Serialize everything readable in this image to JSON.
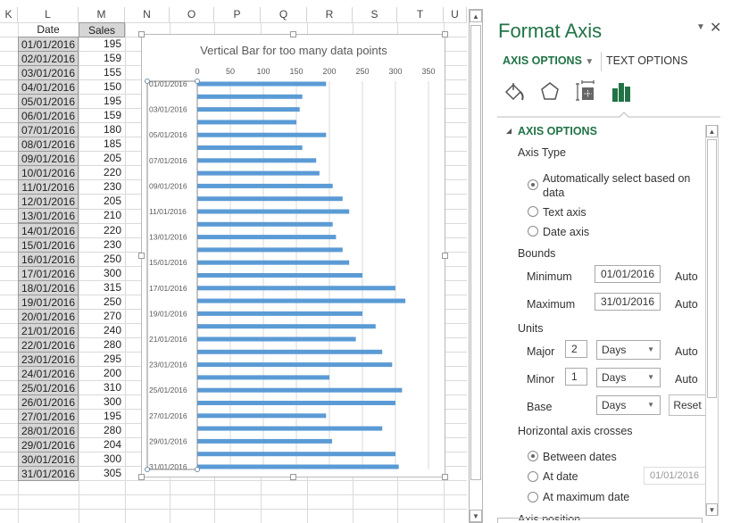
{
  "sheet": {
    "columns": [
      "K",
      "L",
      "M",
      "N",
      "O",
      "P",
      "Q",
      "R",
      "S",
      "T",
      "U"
    ],
    "header_row": {
      "date": "Date",
      "sales": "Sales"
    },
    "rows": [
      {
        "date": "01/01/2016",
        "sales": "195"
      },
      {
        "date": "02/01/2016",
        "sales": "159"
      },
      {
        "date": "03/01/2016",
        "sales": "155"
      },
      {
        "date": "04/01/2016",
        "sales": "150"
      },
      {
        "date": "05/01/2016",
        "sales": "195"
      },
      {
        "date": "06/01/2016",
        "sales": "159"
      },
      {
        "date": "07/01/2016",
        "sales": "180"
      },
      {
        "date": "08/01/2016",
        "sales": "185"
      },
      {
        "date": "09/01/2016",
        "sales": "205"
      },
      {
        "date": "10/01/2016",
        "sales": "220"
      },
      {
        "date": "11/01/2016",
        "sales": "230"
      },
      {
        "date": "12/01/2016",
        "sales": "205"
      },
      {
        "date": "13/01/2016",
        "sales": "210"
      },
      {
        "date": "14/01/2016",
        "sales": "220"
      },
      {
        "date": "15/01/2016",
        "sales": "230"
      },
      {
        "date": "16/01/2016",
        "sales": "250"
      },
      {
        "date": "17/01/2016",
        "sales": "300"
      },
      {
        "date": "18/01/2016",
        "sales": "315"
      },
      {
        "date": "19/01/2016",
        "sales": "250"
      },
      {
        "date": "20/01/2016",
        "sales": "270"
      },
      {
        "date": "21/01/2016",
        "sales": "240"
      },
      {
        "date": "22/01/2016",
        "sales": "280"
      },
      {
        "date": "23/01/2016",
        "sales": "295"
      },
      {
        "date": "24/01/2016",
        "sales": "200"
      },
      {
        "date": "25/01/2016",
        "sales": "310"
      },
      {
        "date": "26/01/2016",
        "sales": "300"
      },
      {
        "date": "27/01/2016",
        "sales": "195"
      },
      {
        "date": "28/01/2016",
        "sales": "280"
      },
      {
        "date": "29/01/2016",
        "sales": "204"
      },
      {
        "date": "30/01/2016",
        "sales": "300"
      },
      {
        "date": "31/01/2016",
        "sales": "305"
      }
    ]
  },
  "chart_data": {
    "type": "bar",
    "orientation": "horizontal",
    "title": "Vertical Bar for too many data points",
    "categories": [
      "01/01/2016",
      "02/01/2016",
      "03/01/2016",
      "04/01/2016",
      "05/01/2016",
      "06/01/2016",
      "07/01/2016",
      "08/01/2016",
      "09/01/2016",
      "10/01/2016",
      "11/01/2016",
      "12/01/2016",
      "13/01/2016",
      "14/01/2016",
      "15/01/2016",
      "16/01/2016",
      "17/01/2016",
      "18/01/2016",
      "19/01/2016",
      "20/01/2016",
      "21/01/2016",
      "22/01/2016",
      "23/01/2016",
      "24/01/2016",
      "25/01/2016",
      "26/01/2016",
      "27/01/2016",
      "28/01/2016",
      "29/01/2016",
      "30/01/2016",
      "31/01/2016"
    ],
    "category_tick_labels": [
      "01/01/2016",
      "03/01/2016",
      "05/01/2016",
      "07/01/2016",
      "09/01/2016",
      "11/01/2016",
      "13/01/2016",
      "15/01/2016",
      "17/01/2016",
      "19/01/2016",
      "21/01/2016",
      "23/01/2016",
      "25/01/2016",
      "27/01/2016",
      "29/01/2016",
      "31/01/2016"
    ],
    "values": [
      195,
      159,
      155,
      150,
      195,
      159,
      180,
      185,
      205,
      220,
      230,
      205,
      210,
      220,
      230,
      250,
      300,
      315,
      250,
      270,
      240,
      280,
      295,
      200,
      310,
      300,
      195,
      280,
      204,
      300,
      305
    ],
    "value_ticks": [
      "0",
      "50",
      "100",
      "150",
      "200",
      "250",
      "300",
      "350"
    ],
    "xlim": [
      0,
      350
    ],
    "value_axis_position": "top",
    "grid": true,
    "bar_color": "#5b9bd5"
  },
  "panel": {
    "title": "Format Axis",
    "tabs": {
      "axis_options": "AXIS OPTIONS",
      "text_options": "TEXT OPTIONS"
    },
    "section": "AXIS OPTIONS",
    "axis_type": {
      "label": "Axis Type",
      "options": [
        "Automatically select based on",
        "data",
        "Text axis",
        "Date axis"
      ],
      "selected": "Automatically select based on data"
    },
    "bounds": {
      "label": "Bounds",
      "minimum_label": "Minimum",
      "minimum_value": "01/01/2016",
      "minimum_auto": "Auto",
      "maximum_label": "Maximum",
      "maximum_value": "31/01/2016",
      "maximum_auto": "Auto"
    },
    "units": {
      "label": "Units",
      "major_label": "Major",
      "major_value": "2",
      "major_unit": "Days",
      "major_auto": "Auto",
      "minor_label": "Minor",
      "minor_value": "1",
      "minor_unit": "Days",
      "minor_auto": "Auto",
      "base_label": "Base",
      "base_unit": "Days",
      "reset": "Reset"
    },
    "crosses": {
      "label": "Horizontal axis crosses",
      "between": "Between dates",
      "at_date": "At date",
      "at_date_value": "01/01/2016",
      "at_max": "At maximum date",
      "selected": "Between dates"
    },
    "next_section": "Axis position",
    "accent_color": "#217346"
  }
}
